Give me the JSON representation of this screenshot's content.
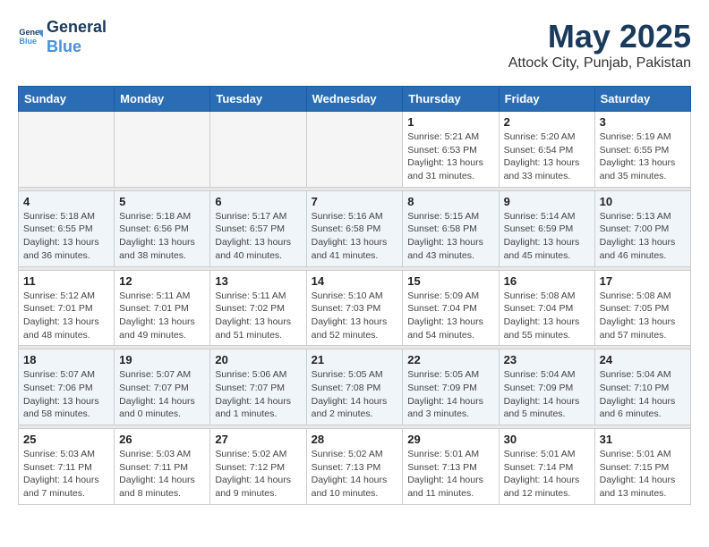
{
  "logo": {
    "line1": "General",
    "line2": "Blue"
  },
  "title": "May 2025",
  "location": "Attock City, Punjab, Pakistan",
  "days_of_week": [
    "Sunday",
    "Monday",
    "Tuesday",
    "Wednesday",
    "Thursday",
    "Friday",
    "Saturday"
  ],
  "weeks": [
    [
      {
        "day": "",
        "sunrise": "",
        "sunset": "",
        "daylight": ""
      },
      {
        "day": "",
        "sunrise": "",
        "sunset": "",
        "daylight": ""
      },
      {
        "day": "",
        "sunrise": "",
        "sunset": "",
        "daylight": ""
      },
      {
        "day": "",
        "sunrise": "",
        "sunset": "",
        "daylight": ""
      },
      {
        "day": "1",
        "sunrise": "5:21 AM",
        "sunset": "6:53 PM",
        "daylight": "13 hours and 31 minutes."
      },
      {
        "day": "2",
        "sunrise": "5:20 AM",
        "sunset": "6:54 PM",
        "daylight": "13 hours and 33 minutes."
      },
      {
        "day": "3",
        "sunrise": "5:19 AM",
        "sunset": "6:55 PM",
        "daylight": "13 hours and 35 minutes."
      }
    ],
    [
      {
        "day": "4",
        "sunrise": "5:18 AM",
        "sunset": "6:55 PM",
        "daylight": "13 hours and 36 minutes."
      },
      {
        "day": "5",
        "sunrise": "5:18 AM",
        "sunset": "6:56 PM",
        "daylight": "13 hours and 38 minutes."
      },
      {
        "day": "6",
        "sunrise": "5:17 AM",
        "sunset": "6:57 PM",
        "daylight": "13 hours and 40 minutes."
      },
      {
        "day": "7",
        "sunrise": "5:16 AM",
        "sunset": "6:58 PM",
        "daylight": "13 hours and 41 minutes."
      },
      {
        "day": "8",
        "sunrise": "5:15 AM",
        "sunset": "6:58 PM",
        "daylight": "13 hours and 43 minutes."
      },
      {
        "day": "9",
        "sunrise": "5:14 AM",
        "sunset": "6:59 PM",
        "daylight": "13 hours and 45 minutes."
      },
      {
        "day": "10",
        "sunrise": "5:13 AM",
        "sunset": "7:00 PM",
        "daylight": "13 hours and 46 minutes."
      }
    ],
    [
      {
        "day": "11",
        "sunrise": "5:12 AM",
        "sunset": "7:01 PM",
        "daylight": "13 hours and 48 minutes."
      },
      {
        "day": "12",
        "sunrise": "5:11 AM",
        "sunset": "7:01 PM",
        "daylight": "13 hours and 49 minutes."
      },
      {
        "day": "13",
        "sunrise": "5:11 AM",
        "sunset": "7:02 PM",
        "daylight": "13 hours and 51 minutes."
      },
      {
        "day": "14",
        "sunrise": "5:10 AM",
        "sunset": "7:03 PM",
        "daylight": "13 hours and 52 minutes."
      },
      {
        "day": "15",
        "sunrise": "5:09 AM",
        "sunset": "7:04 PM",
        "daylight": "13 hours and 54 minutes."
      },
      {
        "day": "16",
        "sunrise": "5:08 AM",
        "sunset": "7:04 PM",
        "daylight": "13 hours and 55 minutes."
      },
      {
        "day": "17",
        "sunrise": "5:08 AM",
        "sunset": "7:05 PM",
        "daylight": "13 hours and 57 minutes."
      }
    ],
    [
      {
        "day": "18",
        "sunrise": "5:07 AM",
        "sunset": "7:06 PM",
        "daylight": "13 hours and 58 minutes."
      },
      {
        "day": "19",
        "sunrise": "5:07 AM",
        "sunset": "7:07 PM",
        "daylight": "14 hours and 0 minutes."
      },
      {
        "day": "20",
        "sunrise": "5:06 AM",
        "sunset": "7:07 PM",
        "daylight": "14 hours and 1 minutes."
      },
      {
        "day": "21",
        "sunrise": "5:05 AM",
        "sunset": "7:08 PM",
        "daylight": "14 hours and 2 minutes."
      },
      {
        "day": "22",
        "sunrise": "5:05 AM",
        "sunset": "7:09 PM",
        "daylight": "14 hours and 3 minutes."
      },
      {
        "day": "23",
        "sunrise": "5:04 AM",
        "sunset": "7:09 PM",
        "daylight": "14 hours and 5 minutes."
      },
      {
        "day": "24",
        "sunrise": "5:04 AM",
        "sunset": "7:10 PM",
        "daylight": "14 hours and 6 minutes."
      }
    ],
    [
      {
        "day": "25",
        "sunrise": "5:03 AM",
        "sunset": "7:11 PM",
        "daylight": "14 hours and 7 minutes."
      },
      {
        "day": "26",
        "sunrise": "5:03 AM",
        "sunset": "7:11 PM",
        "daylight": "14 hours and 8 minutes."
      },
      {
        "day": "27",
        "sunrise": "5:02 AM",
        "sunset": "7:12 PM",
        "daylight": "14 hours and 9 minutes."
      },
      {
        "day": "28",
        "sunrise": "5:02 AM",
        "sunset": "7:13 PM",
        "daylight": "14 hours and 10 minutes."
      },
      {
        "day": "29",
        "sunrise": "5:01 AM",
        "sunset": "7:13 PM",
        "daylight": "14 hours and 11 minutes."
      },
      {
        "day": "30",
        "sunrise": "5:01 AM",
        "sunset": "7:14 PM",
        "daylight": "14 hours and 12 minutes."
      },
      {
        "day": "31",
        "sunrise": "5:01 AM",
        "sunset": "7:15 PM",
        "daylight": "14 hours and 13 minutes."
      }
    ]
  ]
}
